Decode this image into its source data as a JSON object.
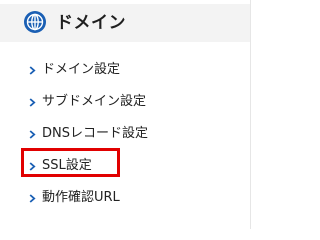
{
  "sidebar": {
    "header": {
      "icon": "globe-icon",
      "title": "ドメイン"
    },
    "items": [
      {
        "label": "ドメイン設定",
        "icon": "chevron-right-icon",
        "selected": false
      },
      {
        "label": "サブドメイン設定",
        "icon": "chevron-right-icon",
        "selected": false
      },
      {
        "label": "DNSレコード設定",
        "icon": "chevron-right-icon",
        "selected": false
      },
      {
        "label": "SSL設定",
        "icon": "chevron-right-icon",
        "selected": true
      },
      {
        "label": "動作確認URL",
        "icon": "chevron-right-icon",
        "selected": false
      }
    ]
  },
  "colors": {
    "accent": "#1a5fb4",
    "header_bg": "#f3f3f3",
    "highlight_border": "#e10000",
    "text": "#222222"
  }
}
